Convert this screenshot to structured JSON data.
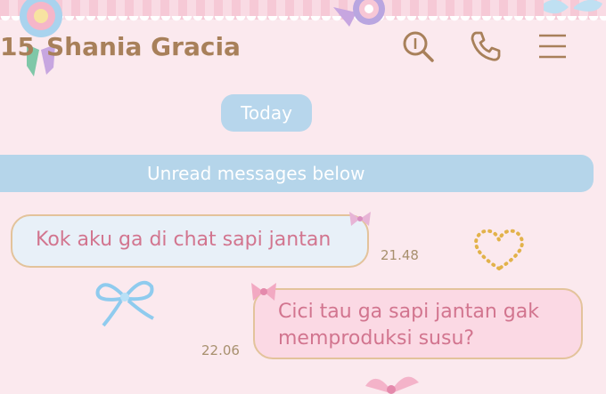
{
  "header": {
    "unread_count": "15",
    "contact_name": "Shania Gracia",
    "icons": [
      "search-icon",
      "phone-icon",
      "menu-icon"
    ]
  },
  "chat": {
    "date_separator": "Today",
    "unread_banner": "Unread messages below",
    "messages": [
      {
        "direction": "incoming",
        "text": "Kok aku ga di chat sapi jantan",
        "time": "21.48"
      },
      {
        "direction": "outgoing",
        "text": "Cici tau ga sapi jantan gak memproduksi susu?",
        "time": "22.06"
      }
    ]
  },
  "theme": {
    "background": "#fbe9ee",
    "header_text": "#a8805a",
    "bubble_text": "#d2758f",
    "pill_blue": "#b7d6ec"
  }
}
